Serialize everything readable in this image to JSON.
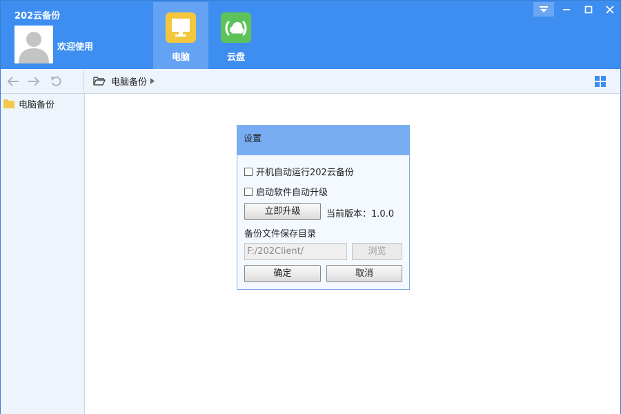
{
  "app": {
    "title": "202云备份",
    "welcome": "欢迎使用"
  },
  "nav": {
    "tabs": [
      {
        "label": "电脑",
        "icon": "monitor-icon",
        "active": true
      },
      {
        "label": "云盘",
        "icon": "cloud-icon",
        "active": false
      }
    ]
  },
  "window_controls": [
    "dropdown-menu-icon",
    "minimize-icon",
    "maximize-icon",
    "close-icon"
  ],
  "toolbar": {
    "icons": [
      "back-arrow-icon",
      "forward-arrow-icon",
      "refresh-icon"
    ],
    "breadcrumb": "电脑备份",
    "view_icon": "grid-view-icon"
  },
  "sidebar": {
    "items": [
      {
        "label": "电脑备份",
        "icon": "folder-icon"
      }
    ]
  },
  "dialog": {
    "title": "设置",
    "autostart_label": "开机自动运行202云备份",
    "autostart_checked": false,
    "autoupgrade_label": "启动软件自动升级",
    "autoupgrade_checked": false,
    "upgrade_button": "立即升级",
    "version_text": "当前版本：1.0.0",
    "dir_label": "备份文件保存目录",
    "dir_value": "F:/202Client/",
    "browse_button": "浏览",
    "ok_button": "确定",
    "cancel_button": "取消"
  },
  "colors": {
    "header_bg": "#3d8ef0",
    "active_tab_bg": "#64a3f4",
    "dialog_title_bg": "#78adf3",
    "monitor_icon_bg": "#f2c73e",
    "cloud_icon_bg": "#5ec25a"
  }
}
